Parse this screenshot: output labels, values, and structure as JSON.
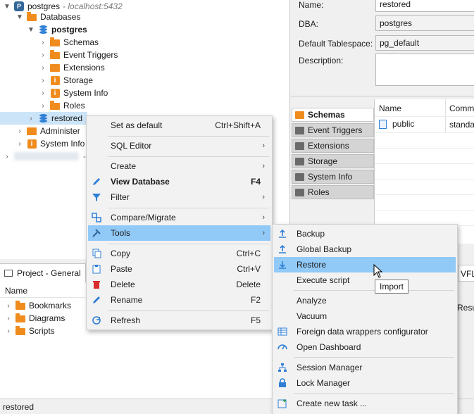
{
  "navigator": {
    "items": [
      {
        "label": "postgres",
        "suffix": "- localhost:5432"
      },
      {
        "label": "Databases"
      },
      {
        "label": "postgres"
      },
      {
        "label": "Schemas"
      },
      {
        "label": "Event Triggers"
      },
      {
        "label": "Extensions"
      },
      {
        "label": "Storage"
      },
      {
        "label": "System Info"
      },
      {
        "label": "Roles"
      },
      {
        "label": "restored"
      },
      {
        "label": "Administer"
      },
      {
        "label": "System Info"
      },
      {
        "label": "-"
      }
    ]
  },
  "project": {
    "tab_label": "Project - General",
    "column_header": "Name",
    "items": [
      {
        "label": "Bookmarks"
      },
      {
        "label": "Diagrams"
      },
      {
        "label": "Scripts"
      }
    ]
  },
  "properties": {
    "name_label": "Name:",
    "name_value": "restored",
    "dba_label": "DBA:",
    "dba_value": "postgres",
    "tablespace_label": "Default Tablespace:",
    "tablespace_value": "pg_default",
    "description_label": "Description:"
  },
  "editor_tabs": [
    {
      "label": "Schemas"
    },
    {
      "label": "Event Triggers"
    },
    {
      "label": "Extensions"
    },
    {
      "label": "Storage"
    },
    {
      "label": "System Info"
    },
    {
      "label": "Roles"
    }
  ],
  "grid": {
    "col_name": "Name",
    "col_comment": "Comm",
    "rows": [
      {
        "name": "public",
        "comment": "standa"
      }
    ]
  },
  "right_fragments": {
    "vflag": "VFLAG",
    "result": "Resul"
  },
  "status_bar": {
    "text": "restored"
  },
  "context_menu": {
    "set_default": {
      "label": "Set as default",
      "shortcut": "Ctrl+Shift+A"
    },
    "sql_editor": {
      "label": "SQL Editor"
    },
    "create": {
      "label": "Create"
    },
    "view_database": {
      "label": "View Database",
      "shortcut": "F4"
    },
    "filter": {
      "label": "Filter"
    },
    "compare_migrate": {
      "label": "Compare/Migrate"
    },
    "tools": {
      "label": "Tools"
    },
    "copy": {
      "label": "Copy",
      "shortcut": "Ctrl+C"
    },
    "paste": {
      "label": "Paste",
      "shortcut": "Ctrl+V"
    },
    "delete": {
      "label": "Delete",
      "shortcut": "Delete"
    },
    "rename": {
      "label": "Rename",
      "shortcut": "F2"
    },
    "refresh": {
      "label": "Refresh",
      "shortcut": "F5"
    }
  },
  "tools_submenu": {
    "backup": "Backup",
    "global_backup": "Global Backup",
    "restore": "Restore",
    "execute_script": "Execute script",
    "analyze": "Analyze",
    "vacuum": "Vacuum",
    "fdw_configurator": "Foreign data wrappers configurator",
    "open_dashboard": "Open Dashboard",
    "session_manager": "Session Manager",
    "lock_manager": "Lock Manager",
    "create_task": "Create new task ..."
  },
  "tooltip": {
    "text": "Import"
  },
  "colors": {
    "selection": "#cce4f7",
    "menu_highlight": "#91c9f7",
    "folder_orange": "#f08c1e",
    "db_blue": "#2f7fd6"
  }
}
